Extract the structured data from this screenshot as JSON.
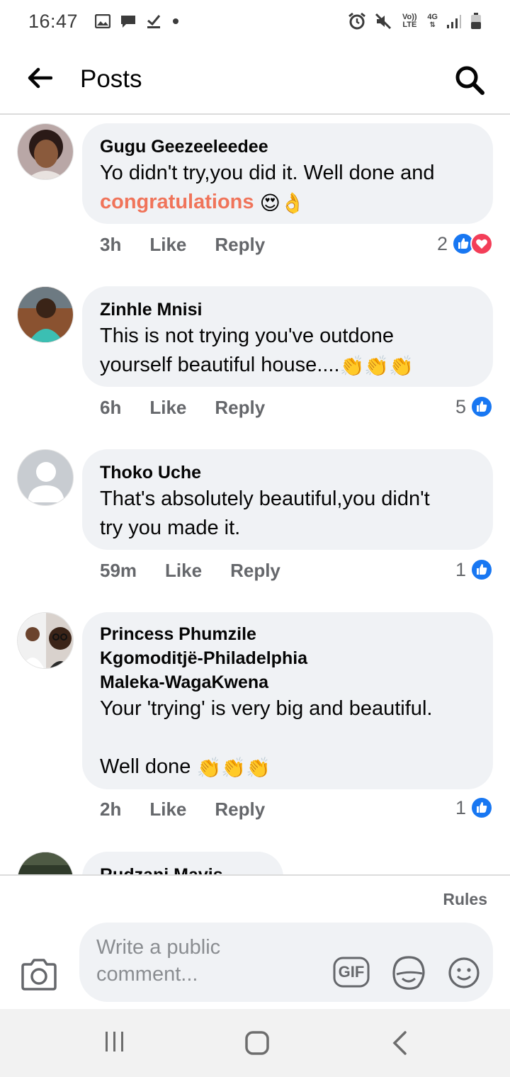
{
  "status_bar": {
    "time": "16:47",
    "network_label": "Vo)) LTE",
    "signal_label": "4G"
  },
  "header": {
    "title": "Posts"
  },
  "comments": [
    {
      "author": "Gugu Geezeeleedee",
      "text": "Yo didn't try,you did it. Well done and",
      "highlight": "congratulations",
      "emoji": "😍👌",
      "time": "3h",
      "like": "Like",
      "reply": "Reply",
      "reaction_count": "2",
      "reactions": [
        "like",
        "love"
      ]
    },
    {
      "author": "Zinhle Mnisi",
      "text_line1": "This is not trying you've outdone",
      "text_line2": "yourself beautiful house....",
      "emoji": "👏👏👏",
      "time": "6h",
      "like": "Like",
      "reply": "Reply",
      "reaction_count": "5",
      "reactions": [
        "like"
      ]
    },
    {
      "author": "Thoko Uche",
      "text_line1": "That's absolutely beautiful,you didn't",
      "text_line2": "try you made it.",
      "time": "59m",
      "like": "Like",
      "reply": "Reply",
      "reaction_count": "1",
      "reactions": [
        "like"
      ]
    },
    {
      "author_line1": "Princess Phumzile",
      "author_line2": "Kgomoditjë-Philadelphia",
      "author_line3": "Maleka-WagaKwena",
      "text_line1": "Your 'trying' is very big and beautiful.",
      "text_line2": "Well done",
      "emoji": "👏👏👏",
      "time": "2h",
      "like": "Like",
      "reply": "Reply",
      "reaction_count": "1",
      "reactions": [
        "like"
      ]
    },
    {
      "author": "Rudzani Mavis"
    }
  ],
  "composer": {
    "rules": "Rules",
    "placeholder_line1": "Write a public",
    "placeholder_line2": "comment...",
    "gif_label": "GIF"
  },
  "colors": {
    "bubble": "#f0f2f5",
    "like_blue": "#1877f2",
    "love_red": "#f33e58",
    "highlight": "#f0745a"
  }
}
